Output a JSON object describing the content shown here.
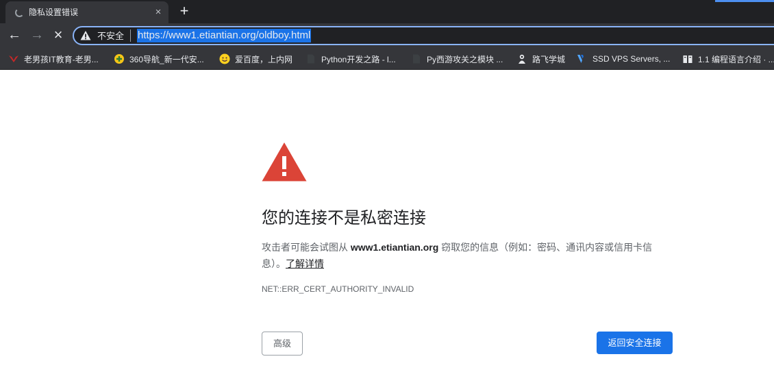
{
  "tab": {
    "title": "隐私设置错误",
    "close_glyph": "×"
  },
  "new_tab_glyph": "+",
  "toolbar": {
    "back_glyph": "←",
    "forward_glyph": "→",
    "stop_glyph": "×",
    "security_label": "不安全",
    "url": "https://www1.etiantian.org/oldboy.html"
  },
  "bookmarks": [
    {
      "label": "老男孩IT教育-老男...",
      "icon": "oldboy-logo-icon"
    },
    {
      "label": "360导航_新一代安...",
      "icon": "360-logo-icon"
    },
    {
      "label": "爱百度，上内网",
      "icon": "smiley-icon"
    },
    {
      "label": "Python开发之路 - l...",
      "icon": "blank-page-icon"
    },
    {
      "label": "Py西游攻关之模块 ...",
      "icon": "blank-page-icon"
    },
    {
      "label": "路飞学城",
      "icon": "luffy-logo-icon"
    },
    {
      "label": "SSD VPS Servers, ...",
      "icon": "vultr-logo-icon"
    },
    {
      "label": "1.1 编程语言介绍 · ...",
      "icon": "book-icon"
    }
  ],
  "content": {
    "heading": "您的连接不是私密连接",
    "desc_before": "攻击者可能会试图从 ",
    "desc_host": "www1.etiantian.org",
    "desc_after": " 窃取您的信息（例如：密码、通讯内容或信用卡信息）。",
    "learn_more": "了解详情",
    "error_code": "NET::ERR_CERT_AUTHORITY_INVALID",
    "advanced_button": "高级",
    "back_to_safety_button": "返回安全连接"
  },
  "colors": {
    "tabstrip_bg": "#202124",
    "toolbar_bg": "#35363a",
    "omnibox_focus": "#8ab4f8",
    "url_selection": "#1a73e8",
    "warning_red": "#db4437",
    "primary_button": "#1a73e8"
  }
}
